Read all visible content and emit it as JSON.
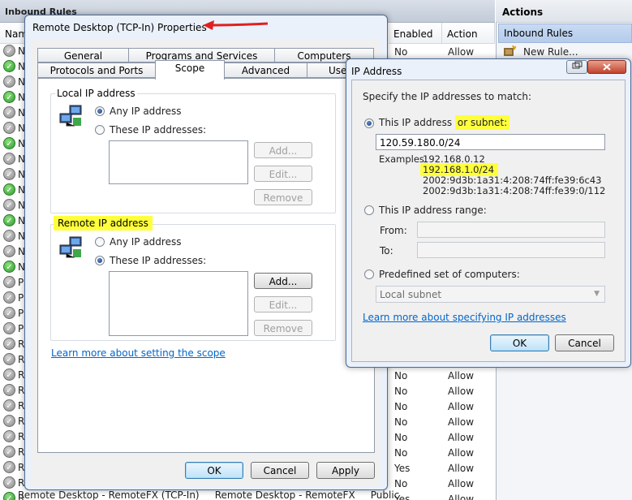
{
  "mmc": {
    "header_title": "Inbound Rules",
    "columns": {
      "name": "Nam",
      "enabled": "Enabled",
      "action": "Action"
    },
    "rule_letters": [
      "N",
      "N",
      "N",
      "N",
      "N",
      "N",
      "N",
      "N",
      "N",
      "N",
      "N",
      "N",
      "N",
      "N",
      "N",
      "P",
      "P",
      "P",
      "P",
      "R",
      "R",
      "R",
      "R",
      "R",
      "R",
      "R",
      "R",
      "R",
      "R",
      "R",
      "R"
    ],
    "rows_right": [
      {
        "enabled": "No",
        "action": "Allow"
      },
      {
        "enabled": "No",
        "action": "Allow"
      },
      {
        "enabled": "No",
        "action": "Allow"
      },
      {
        "enabled": "No",
        "action": "Allow"
      },
      {
        "enabled": "No",
        "action": "Allow"
      },
      {
        "enabled": "No",
        "action": "Allow"
      },
      {
        "enabled": "Yes",
        "action": "Allow"
      },
      {
        "enabled": "No",
        "action": "Allow"
      },
      {
        "enabled": "Yes",
        "action": "Allow"
      }
    ],
    "last_row_text": "Remote Desktop - RemoteFX (TCP-In)     Remote Desktop - RemoteFX     Public"
  },
  "actions": {
    "title": "Actions",
    "subtitle": "Inbound Rules",
    "new_rule": "New Rule..."
  },
  "props": {
    "title": "Remote Desktop (TCP-In) Properties",
    "tabs_row1": [
      "General",
      "Programs and Services",
      "Computers"
    ],
    "tabs_row2": [
      "Protocols and Ports",
      "Scope",
      "Advanced",
      "Use"
    ],
    "local_group": "Local IP address",
    "any_ip": "Any IP address",
    "these_ips": "These IP addresses:",
    "add": "Add...",
    "edit": "Edit...",
    "remove": "Remove",
    "remote_group": "Remote IP address",
    "learn": "Learn more about setting the scope",
    "ok": "OK",
    "cancel": "Cancel",
    "apply": "Apply"
  },
  "ipdlg": {
    "title": "IP Address",
    "specify": "Specify the IP addresses to match:",
    "this_ip_a": "This IP address ",
    "this_ip_b": "or subnet:",
    "value": "120.59.180.0/24",
    "examples_label": "Examples:",
    "examples": [
      "192.168.0.12",
      "192.168.1.0/24",
      "2002:9d3b:1a31:4:208:74ff:fe39:6c43",
      "2002:9d3b:1a31:4:208:74ff:fe39:0/112"
    ],
    "range": "This IP address range:",
    "from": "From:",
    "to": "To:",
    "predefined": "Predefined set of computers:",
    "local_subnet": "Local subnet",
    "learn": "Learn more about specifying IP addresses",
    "ok": "OK",
    "cancel": "Cancel"
  },
  "colors": {
    "highlight": "#ffff3c",
    "arrow": "#e02020",
    "link": "#0066cc"
  }
}
